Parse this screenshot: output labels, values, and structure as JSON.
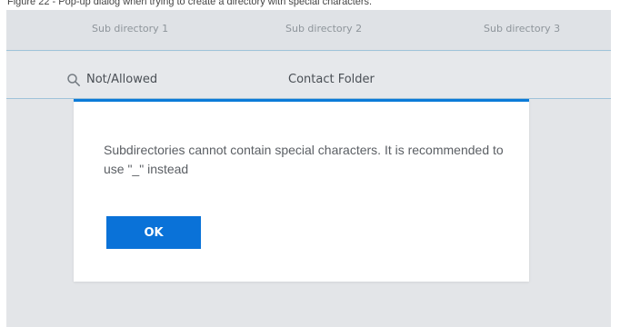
{
  "caption": "Figure 22 - Pop-up dialog when trying to create a directory with special characters.",
  "table": {
    "headers": [
      "Sub directory 1",
      "Sub directory 2",
      "Sub directory 3"
    ],
    "row": {
      "cell_1": "Not/Allowed",
      "cell_2": "Contact Folder"
    }
  },
  "dialog": {
    "message": "Subdirectories cannot contain special characters. It is recommended to use \"_\" instead",
    "ok_label": "OK"
  },
  "icons": {
    "search": "search-icon"
  },
  "colors": {
    "accent": "#0a72d8",
    "divider": "#9fc3d9"
  }
}
